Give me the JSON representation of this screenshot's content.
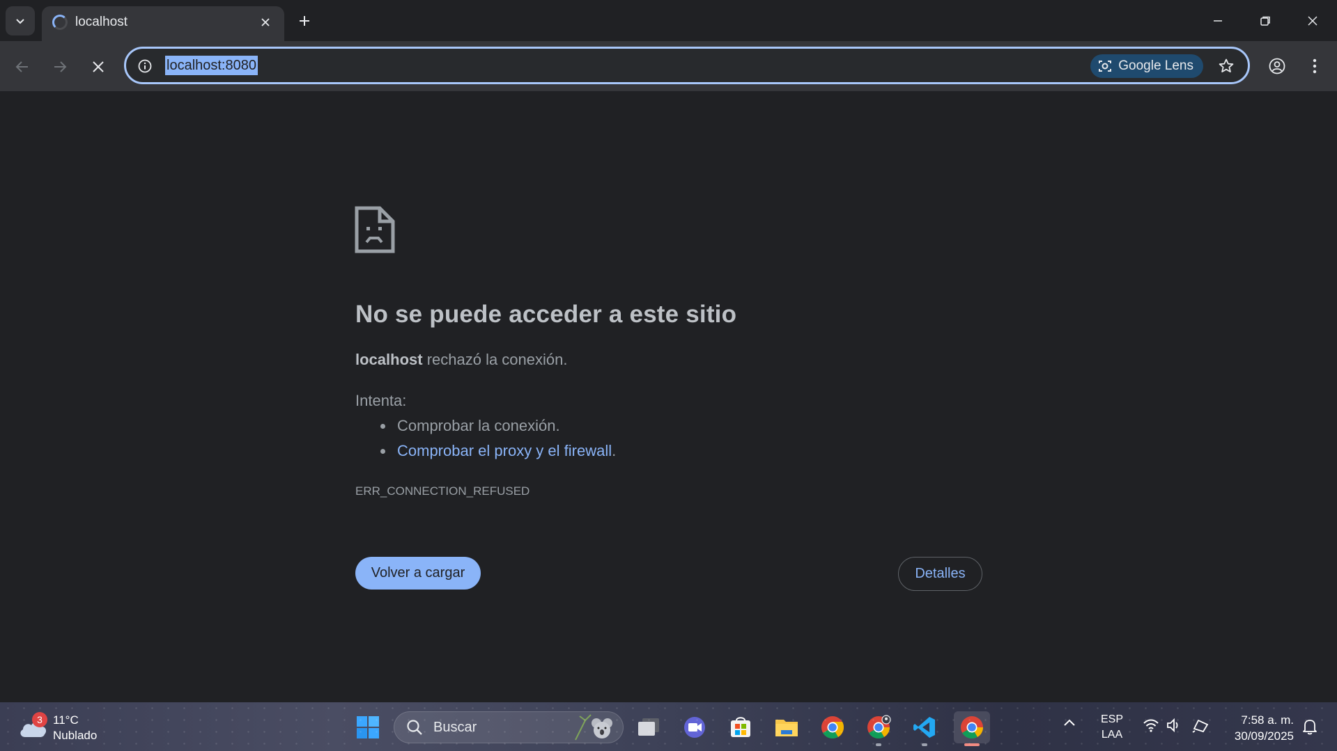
{
  "browser": {
    "tab_title": "localhost",
    "url": "localhost:8080",
    "lens_label": "Google Lens"
  },
  "error": {
    "title": "No se puede acceder a este sitio",
    "host": "localhost",
    "message_suffix": " rechazó la conexión.",
    "try_label": "Intenta:",
    "suggestion_1": "Comprobar la conexión.",
    "suggestion_2_link": "Comprobar el proxy y el firewall",
    "suggestion_2_suffix": ".",
    "code": "ERR_CONNECTION_REFUSED",
    "reload_button": "Volver a cargar",
    "details_button": "Detalles"
  },
  "taskbar": {
    "weather_badge": "3",
    "weather_temp": "11°C",
    "weather_condition": "Nublado",
    "search_label": "Buscar",
    "language": "ESP",
    "keyboard_layout": "LAA",
    "time": "7:58 a. m.",
    "date": "30/09/2025"
  },
  "colors": {
    "accent": "#8ab4f8",
    "page_background": "#202124",
    "toolbar": "#35363a"
  }
}
